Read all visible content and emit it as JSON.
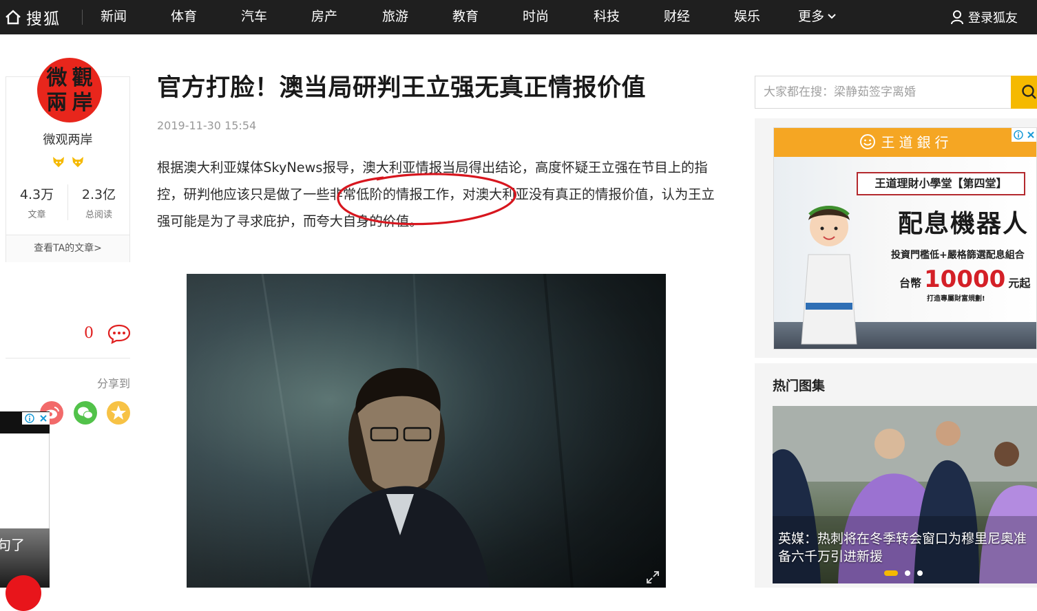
{
  "topnav": {
    "logo": "搜狐",
    "items": [
      "新闻",
      "体育",
      "汽车",
      "房产",
      "旅游",
      "教育",
      "时尚",
      "科技",
      "财经",
      "娱乐"
    ],
    "more": "更多",
    "login": "登录狐友"
  },
  "author": {
    "avatar_chars": [
      "微",
      "觀",
      "兩",
      "岸"
    ],
    "name": "微观两岸",
    "articles_count": "4.3万",
    "articles_label": "文章",
    "reads_count": "2.3亿",
    "reads_label": "总阅读",
    "link": "查看TA的文章>"
  },
  "engagement": {
    "comment_count": "0",
    "share_label": "分享到"
  },
  "left_ad": {
    "text": "句了"
  },
  "article": {
    "title": "官方打脸！澳当局研判王立强无真正情报价值",
    "time": "2019-11-30 15:54",
    "body": "根据澳大利亚媒体SkyNews报导，澳大利亚情报当局得出结论，高度怀疑王立强在节目上的指控，研判他应该只是做了一些非常低阶的情报工作，对澳大利亚没有真正的情报价值，认为王立强可能是为了寻求庇护，而夸大自身的价值。"
  },
  "search": {
    "placeholder": "大家都在搜：梁静茹签字离婚"
  },
  "ad": {
    "brand": "王道銀行",
    "tag": "王道理財小學堂【第四堂】",
    "headline": "配息機器人",
    "sub": "投資門檻低+嚴格篩選配息組合",
    "price_pre": "台幣",
    "price": "10000",
    "price_post": "元起",
    "tiny": "打造專屬財富規劃!"
  },
  "gallery": {
    "title": "热门图集",
    "caption": "英媒：热刺将在冬季转会窗口为穆里尼奥准备六千万引进新援"
  },
  "colors": {
    "nav_bg": "#1f1f1f",
    "accent_yellow": "#f5b900",
    "brand_red": "#e8261c",
    "ad_orange": "#f5a623"
  }
}
